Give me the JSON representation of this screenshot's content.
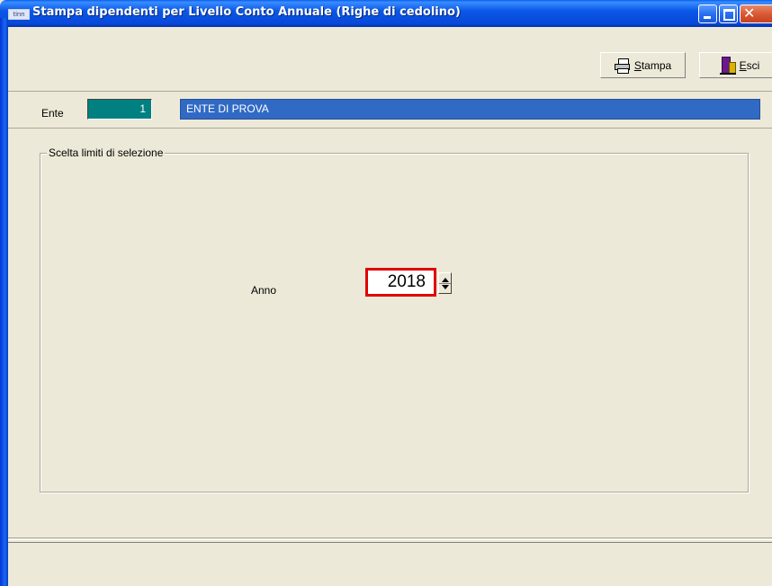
{
  "window": {
    "title": "Stampa dipendenti per Livello Conto Annuale (Righe di cedolino)",
    "app_icon_text": "tinn",
    "controls": [
      "minimize-icon",
      "maximize-icon",
      "close-icon"
    ]
  },
  "toolbar": {
    "stampa_accel": "S",
    "stampa_rest": "tampa",
    "esci_accel": "E",
    "esci_rest": "sci"
  },
  "ente": {
    "label": "Ente",
    "code": "1",
    "name": "ENTE DI PROVA"
  },
  "selection": {
    "group_title": "Scelta limiti di selezione",
    "anno_label": "Anno",
    "anno_value": "2018"
  },
  "colors": {
    "titlebar": "#0a58e8",
    "ente_code_bg": "#008080",
    "ente_name_bg": "#316ac5",
    "highlight": "#e00000",
    "window_bg": "#ece9d8"
  }
}
